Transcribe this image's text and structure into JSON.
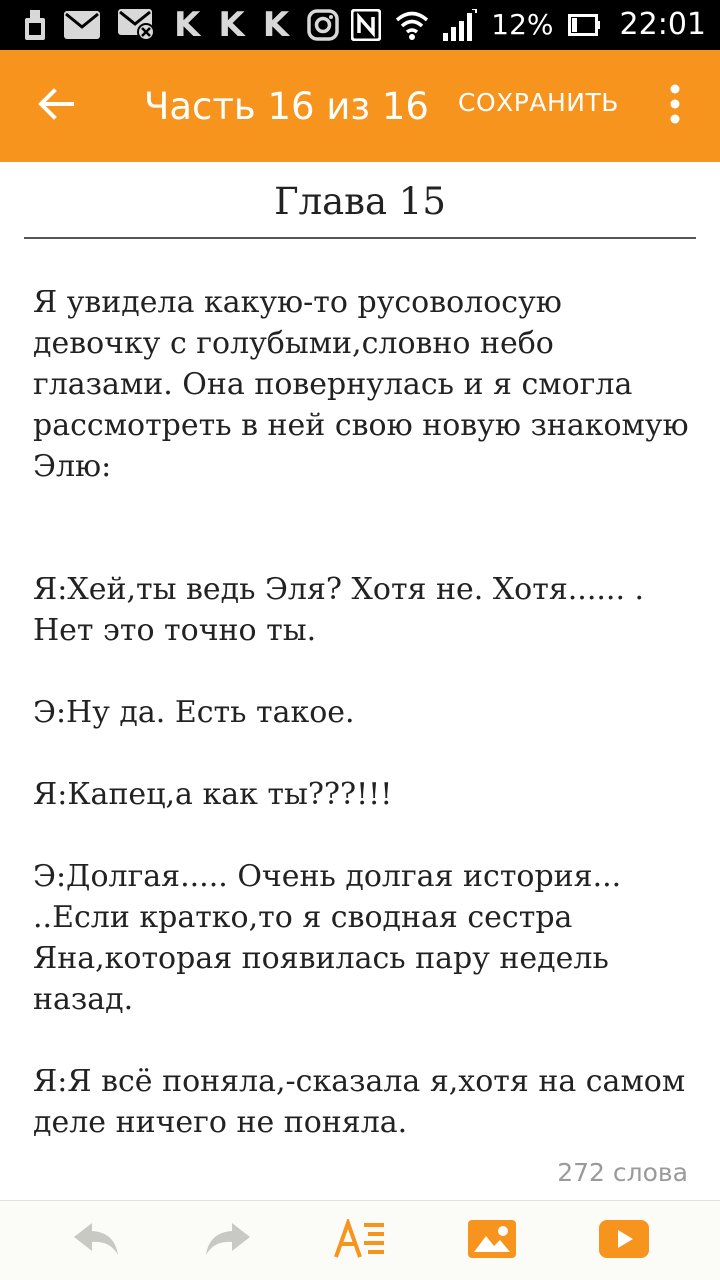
{
  "status_bar": {
    "icons": [
      "sim-icon",
      "mail-icon",
      "mail-muted-icon",
      "k-icon",
      "k-icon",
      "k-icon",
      "instagram-icon",
      "nfc-icon",
      "wifi-icon",
      "signal-icon",
      "battery-icon"
    ],
    "k_letter": "K",
    "battery": "12%",
    "time": "22:01"
  },
  "app_bar": {
    "title": "Часть 16 из 16",
    "save_label": "СОХРАНИТЬ",
    "color": "#f7941d"
  },
  "chapter": {
    "title": "Глава 15",
    "paragraphs": [
      "Я увидела какую-то русоволосую девочку с голубыми,словно небо глазами. Она повернулась и я смогла рассмотреть в ней свою новую знакомую Элю:",
      "Я:Хей,ты ведь Эля? Хотя не. Хотя...... . Нет это точно ты.",
      "Э:Ну да. Есть такое.",
      "Я:Капец,а как ты???!!!",
      "Э:Долгая..... Очень долгая история... ..Если кратко,то я сводная сестра Яна,которая появилась пару недель назад.",
      "Я:Я всё поняла,-сказала я,хотя на самом деле ничего не поняла."
    ],
    "word_count": "272 слова"
  },
  "toolbar": {
    "icons": [
      "undo-icon",
      "redo-icon",
      "text-format-icon",
      "insert-image-icon",
      "insert-video-icon"
    ],
    "accent": "#f7941d",
    "disabled": "#c9c9c4"
  }
}
